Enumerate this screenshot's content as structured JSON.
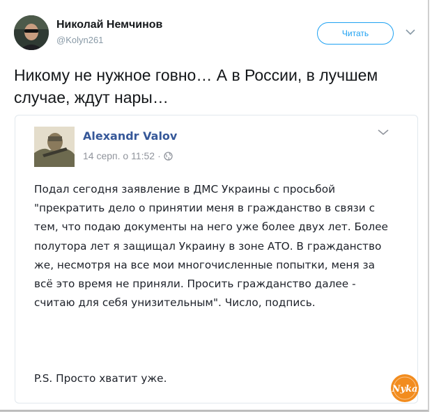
{
  "tweet": {
    "author_name": "Николай Немчинов",
    "author_handle": "@Kolyn261",
    "follow_label": "Читать",
    "text": "Никому не нужное говно…  А в России, в лучшем  случае, ждут нары…"
  },
  "quoted_post": {
    "author_name": "Alexandr Valov",
    "date": "14 серп. о 11:52",
    "separator": "·",
    "privacy_icon": "globe-icon",
    "body": "Подал сегодня заявление в ДМС Украины с просьбой \"прекратить дело о принятии меня в гражданство в связи с тем, что подаю документы на него уже более двух лет. Более полутора лет я защищал Украину в зоне АТО. В гражданство же, несмотря на все мои многочисленные попытки, меня за всё это время не приняли. Просить гражданство далее - считаю для себя унизительным\". Число, подпись.",
    "ps": "P.S. Просто хватит уже."
  },
  "watermark": {
    "text": "Nyka",
    "color": "#f28c1e"
  },
  "colors": {
    "twitter_blue": "#1da1f2",
    "facebook_name": "#365899",
    "muted": "#8899a6"
  }
}
